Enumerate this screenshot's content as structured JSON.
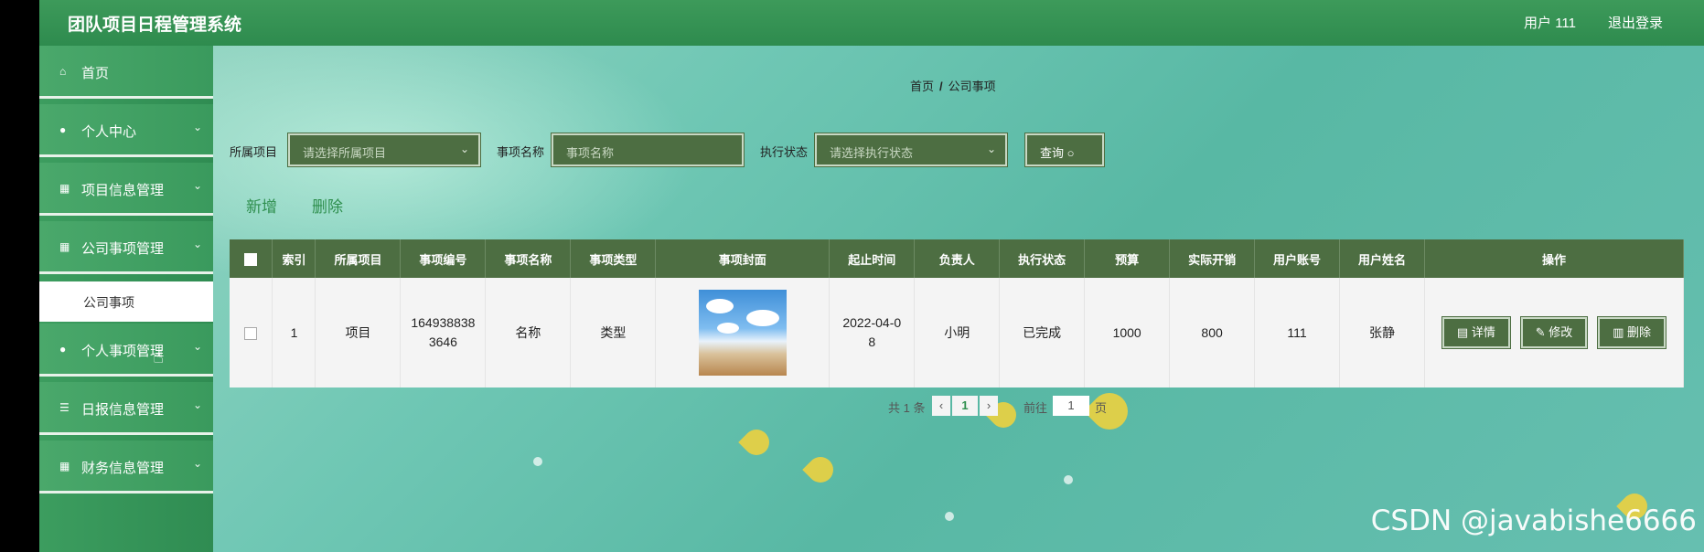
{
  "header": {
    "title": "团队项目日程管理系统",
    "user": "用户 111",
    "logout": "退出登录"
  },
  "sidebar": {
    "items": [
      {
        "label": "首页",
        "icon": "home-icon",
        "glyph": "⌂"
      },
      {
        "label": "个人中心",
        "icon": "user-icon",
        "glyph": "●"
      },
      {
        "label": "项目信息管理",
        "icon": "grid-icon",
        "glyph": "▦"
      },
      {
        "label": "公司事项管理",
        "icon": "grid-icon",
        "glyph": "▦"
      },
      {
        "label": "个人事项管理",
        "icon": "user-icon",
        "glyph": "●"
      },
      {
        "label": "日报信息管理",
        "icon": "sliders-icon",
        "glyph": "☰"
      },
      {
        "label": "财务信息管理",
        "icon": "apps-icon",
        "glyph": "▦"
      }
    ],
    "active_sub": "公司事项"
  },
  "breadcrumb": {
    "home": "首页",
    "sep": "/",
    "current": "公司事项"
  },
  "search": {
    "project_label": "所属项目",
    "project_placeholder": "请选择所属项目",
    "name_label": "事项名称",
    "name_placeholder": "事项名称",
    "status_label": "执行状态",
    "status_placeholder": "请选择执行状态",
    "button": "查询"
  },
  "actions": {
    "add": "新增",
    "delete": "删除"
  },
  "table": {
    "headers": [
      "索引",
      "所属项目",
      "事项编号",
      "事项名称",
      "事项类型",
      "事项封面",
      "起止时间",
      "负责人",
      "执行状态",
      "预算",
      "实际开销",
      "用户账号",
      "用户姓名",
      "操作"
    ],
    "rows": [
      {
        "index": "1",
        "project": "项目",
        "code": "1649388383646",
        "name": "名称",
        "type": "类型",
        "time": "2022-04-08",
        "owner": "小明",
        "status": "已完成",
        "budget": "1000",
        "cost": "800",
        "account": "111",
        "username": "张静"
      }
    ],
    "ops": {
      "detail": "详情",
      "edit": "修改",
      "remove": "删除"
    }
  },
  "pager": {
    "total": "共 1 条",
    "page": "1",
    "goto": "前往",
    "goto_value": "1",
    "page_unit": "页"
  },
  "watermark": "CSDN @javabishe6666"
}
